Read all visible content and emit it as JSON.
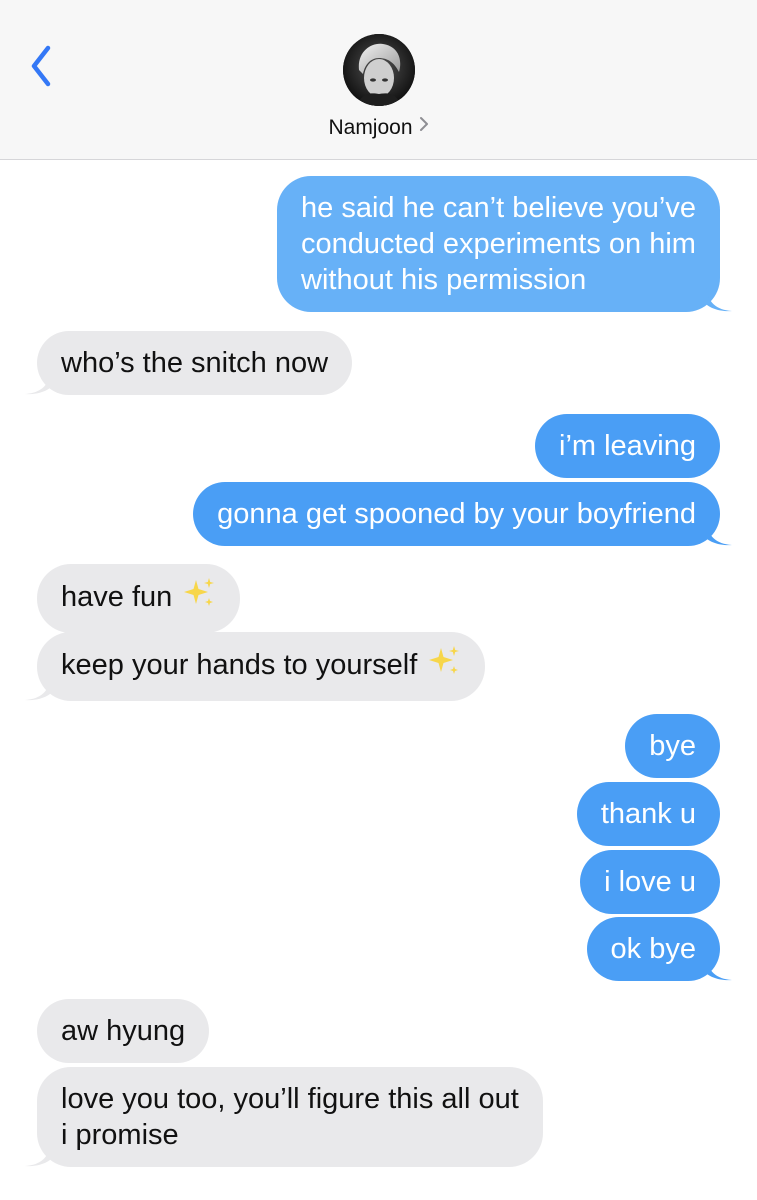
{
  "header": {
    "back_icon": "chevron-left-icon",
    "contact_name": "Namjoon",
    "accent_color": "#3478f6"
  },
  "messages": [
    {
      "side": "sent",
      "lines": [
        "he said he can’t believe you’ve",
        "conducted experiments on him",
        "without his permission"
      ]
    },
    {
      "side": "received",
      "text": "who’s the snitch now"
    },
    {
      "side": "sent",
      "text": "i’m leaving"
    },
    {
      "side": "sent",
      "text": "gonna get spooned by your boyfriend"
    },
    {
      "side": "received",
      "text": "have fun",
      "emoji": "sparkles"
    },
    {
      "side": "received",
      "text": "keep your hands to yourself",
      "emoji": "sparkles"
    },
    {
      "side": "sent",
      "text": "bye"
    },
    {
      "side": "sent",
      "text": "thank u"
    },
    {
      "side": "sent",
      "text": "i love u"
    },
    {
      "side": "sent",
      "text": "ok bye"
    },
    {
      "side": "received",
      "text": "aw hyung"
    },
    {
      "side": "received",
      "lines": [
        "love you too, you’ll figure this all out",
        "i promise"
      ]
    }
  ],
  "colors": {
    "sent_bubble": "#4a9ef5",
    "received_bubble": "#e9e9eb",
    "header_bg": "#f7f7f7"
  }
}
